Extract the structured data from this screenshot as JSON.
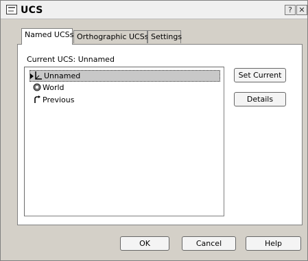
{
  "window": {
    "title": "UCS"
  },
  "titlebar": {
    "help_glyph": "?",
    "close_glyph": "✕"
  },
  "tabs": [
    {
      "label": "Named UCSs",
      "active": true
    },
    {
      "label": "Orthographic UCSs",
      "active": false
    },
    {
      "label": "Settings",
      "active": false
    }
  ],
  "named": {
    "current_label": "Current UCS:  Unnamed",
    "items": [
      {
        "label": "Unnamed",
        "icon": "ucs-axes-icon",
        "selected": true
      },
      {
        "label": "World",
        "icon": "world-globe-icon",
        "selected": false
      },
      {
        "label": "Previous",
        "icon": "undo-arrow-icon",
        "selected": false
      }
    ],
    "set_current_label": "Set Current",
    "details_label": "Details"
  },
  "footer": {
    "ok_label": "OK",
    "cancel_label": "Cancel",
    "help_label": "Help"
  }
}
